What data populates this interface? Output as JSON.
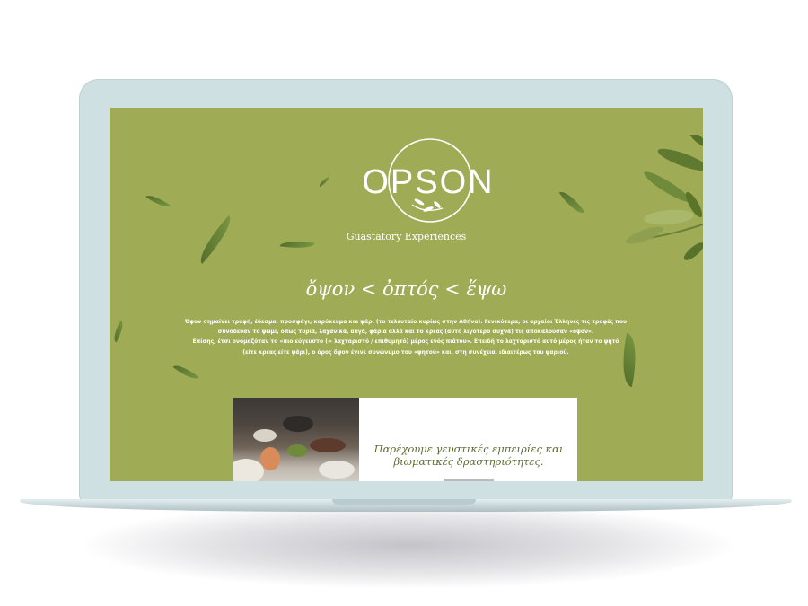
{
  "brand": {
    "logo_text": "OPSON",
    "tagline": "Guastatory Experiences"
  },
  "hero": {
    "heading": "ὄψον < ὀπτός < ἕψω",
    "paragraph": [
      "Όψον σημαίνει τροφή, έδεσμα, προσφάγι, καρύκευμα και ψάρι (το τελευταίο κυρίως στην Αθήνα). Γενικότερα, οι αρχαίοι Έλληνες τις τροφές που",
      "συνόδευαν το ψωμί, όπως τυριά,  λαχανικά, αυγά, φάρια αλλά και το κρέας (αυτό λιγότερο συχνά) τις αποκαλούσαν «όψον».",
      "Επίσης, έτσι ονομαζόταν το «πιο εύγευστο (= λαχταριστό / επιθυμητό) μέρος ενός πιάτου». Επειδή το λαχταριστό αυτό μέρος ήταν το ψητό",
      "(είτε κρέας είτε ψάρι), ο όρος ὄψον έγινε συνώνυμο του «ψητού» και, στη συνέχεια, ιδιαιτέρως του ψαριού."
    ]
  },
  "card": {
    "text_line1": "Παρέχουμε γευστικές εμπειρίες και",
    "text_line2": "βιωματικές δραστηριότητες."
  },
  "colors": {
    "screen_background": "#9fab55",
    "laptop_frame": "#cfe0e3",
    "card_text": "#5b6d2f"
  }
}
